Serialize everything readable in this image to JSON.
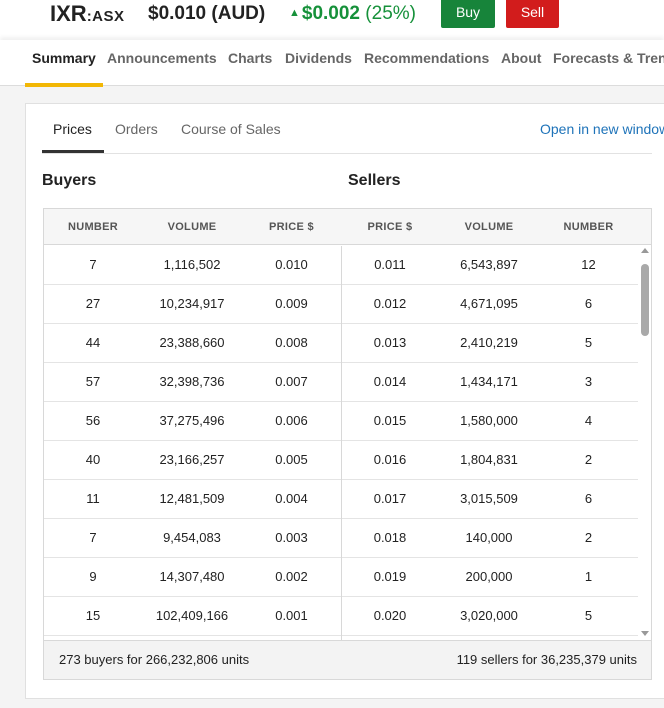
{
  "header": {
    "symbol": "IXR",
    "exchange": ":ASX",
    "price": "$0.010 (AUD)",
    "change_arrow": "▲",
    "change_amount": "$0.002",
    "change_percent": "(25%)",
    "buy_label": "Buy",
    "sell_label": "Sell",
    "colors": {
      "positive": "#16913a",
      "buy": "#17843a",
      "sell": "#d21c1c",
      "active_tab": "#f2b705"
    }
  },
  "nav": {
    "items": [
      "Summary",
      "Announcements",
      "Charts",
      "Dividends",
      "Recommendations",
      "About",
      "Forecasts & Tren"
    ],
    "active": "Summary"
  },
  "subtabs": {
    "items": [
      "Prices",
      "Orders",
      "Course of Sales"
    ],
    "active": "Prices",
    "open_link": "Open in new window"
  },
  "buyers_title": "Buyers",
  "sellers_title": "Sellers",
  "table": {
    "headers": [
      "NUMBER",
      "VOLUME",
      "PRICE $",
      "PRICE $",
      "VOLUME",
      "NUMBER"
    ],
    "rows": [
      [
        "7",
        "1,116,502",
        "0.010",
        "0.011",
        "6,543,897",
        "12"
      ],
      [
        "27",
        "10,234,917",
        "0.009",
        "0.012",
        "4,671,095",
        "6"
      ],
      [
        "44",
        "23,388,660",
        "0.008",
        "0.013",
        "2,410,219",
        "5"
      ],
      [
        "57",
        "32,398,736",
        "0.007",
        "0.014",
        "1,434,171",
        "3"
      ],
      [
        "56",
        "37,275,496",
        "0.006",
        "0.015",
        "1,580,000",
        "4"
      ],
      [
        "40",
        "23,166,257",
        "0.005",
        "0.016",
        "1,804,831",
        "2"
      ],
      [
        "11",
        "12,481,509",
        "0.004",
        "0.017",
        "3,015,509",
        "6"
      ],
      [
        "7",
        "9,454,083",
        "0.003",
        "0.018",
        "140,000",
        "2"
      ],
      [
        "9",
        "14,307,480",
        "0.002",
        "0.019",
        "200,000",
        "1"
      ],
      [
        "15",
        "102,409,166",
        "0.001",
        "0.020",
        "3,020,000",
        "5"
      ]
    ],
    "footer_buyers": "273 buyers for 266,232,806 units",
    "footer_sellers": "119 sellers for 36,235,379 units"
  }
}
